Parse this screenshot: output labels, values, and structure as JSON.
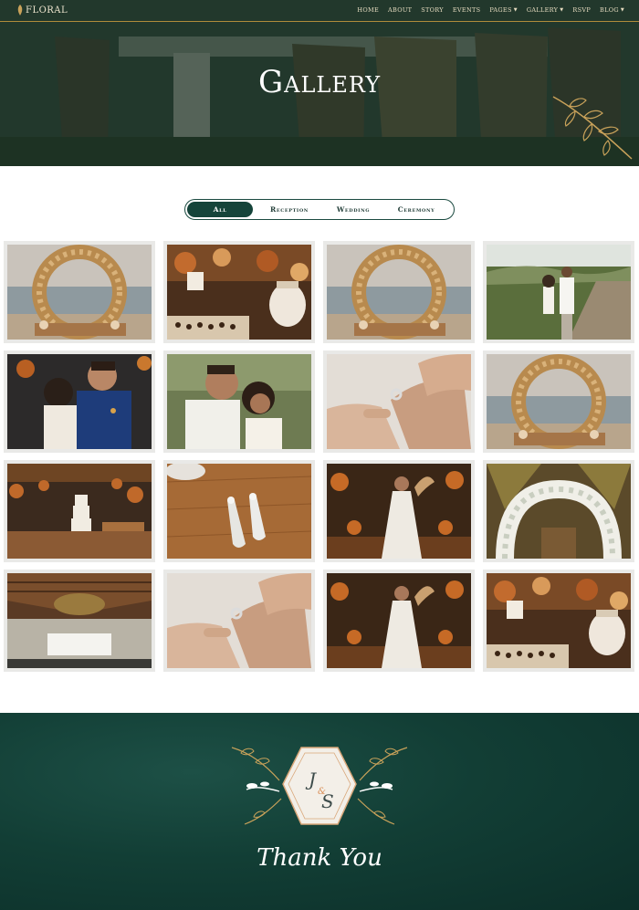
{
  "header": {
    "logo": "FLORAL",
    "nav": [
      {
        "label": "HOME",
        "caret": false
      },
      {
        "label": "ABOUT",
        "caret": false
      },
      {
        "label": "STORY",
        "caret": false
      },
      {
        "label": "EVENTS",
        "caret": false
      },
      {
        "label": "PAGES",
        "caret": true
      },
      {
        "label": "GALLERY",
        "caret": true
      },
      {
        "label": "RSVP",
        "caret": false
      },
      {
        "label": "BLOG",
        "caret": true
      }
    ],
    "title": "Gallery"
  },
  "filters": {
    "items": [
      "All",
      "Reception",
      "Wedding",
      "Ceremony"
    ],
    "active": "All"
  },
  "gallery": {
    "photos": [
      {
        "subject": "floral-arch-beach"
      },
      {
        "subject": "dessert-table"
      },
      {
        "subject": "floral-arch-beach"
      },
      {
        "subject": "couple-boardwalk"
      },
      {
        "subject": "couple-dancing"
      },
      {
        "subject": "couple-smiling"
      },
      {
        "subject": "ring-hands"
      },
      {
        "subject": "floral-arch-beach"
      },
      {
        "subject": "reception-cake"
      },
      {
        "subject": "earrings-wood"
      },
      {
        "subject": "bride-reception"
      },
      {
        "subject": "white-floral-arch"
      },
      {
        "subject": "pavilion-hall"
      },
      {
        "subject": "ring-hands"
      },
      {
        "subject": "bride-reception"
      },
      {
        "subject": "dessert-table"
      }
    ]
  },
  "footer": {
    "monogram_left": "J",
    "monogram_amp": "&",
    "monogram_right": "S",
    "thanks": "Thank You"
  },
  "colors": {
    "accent_green": "#15443a",
    "gold": "#c9a25a",
    "footer_green": "#123e35"
  }
}
